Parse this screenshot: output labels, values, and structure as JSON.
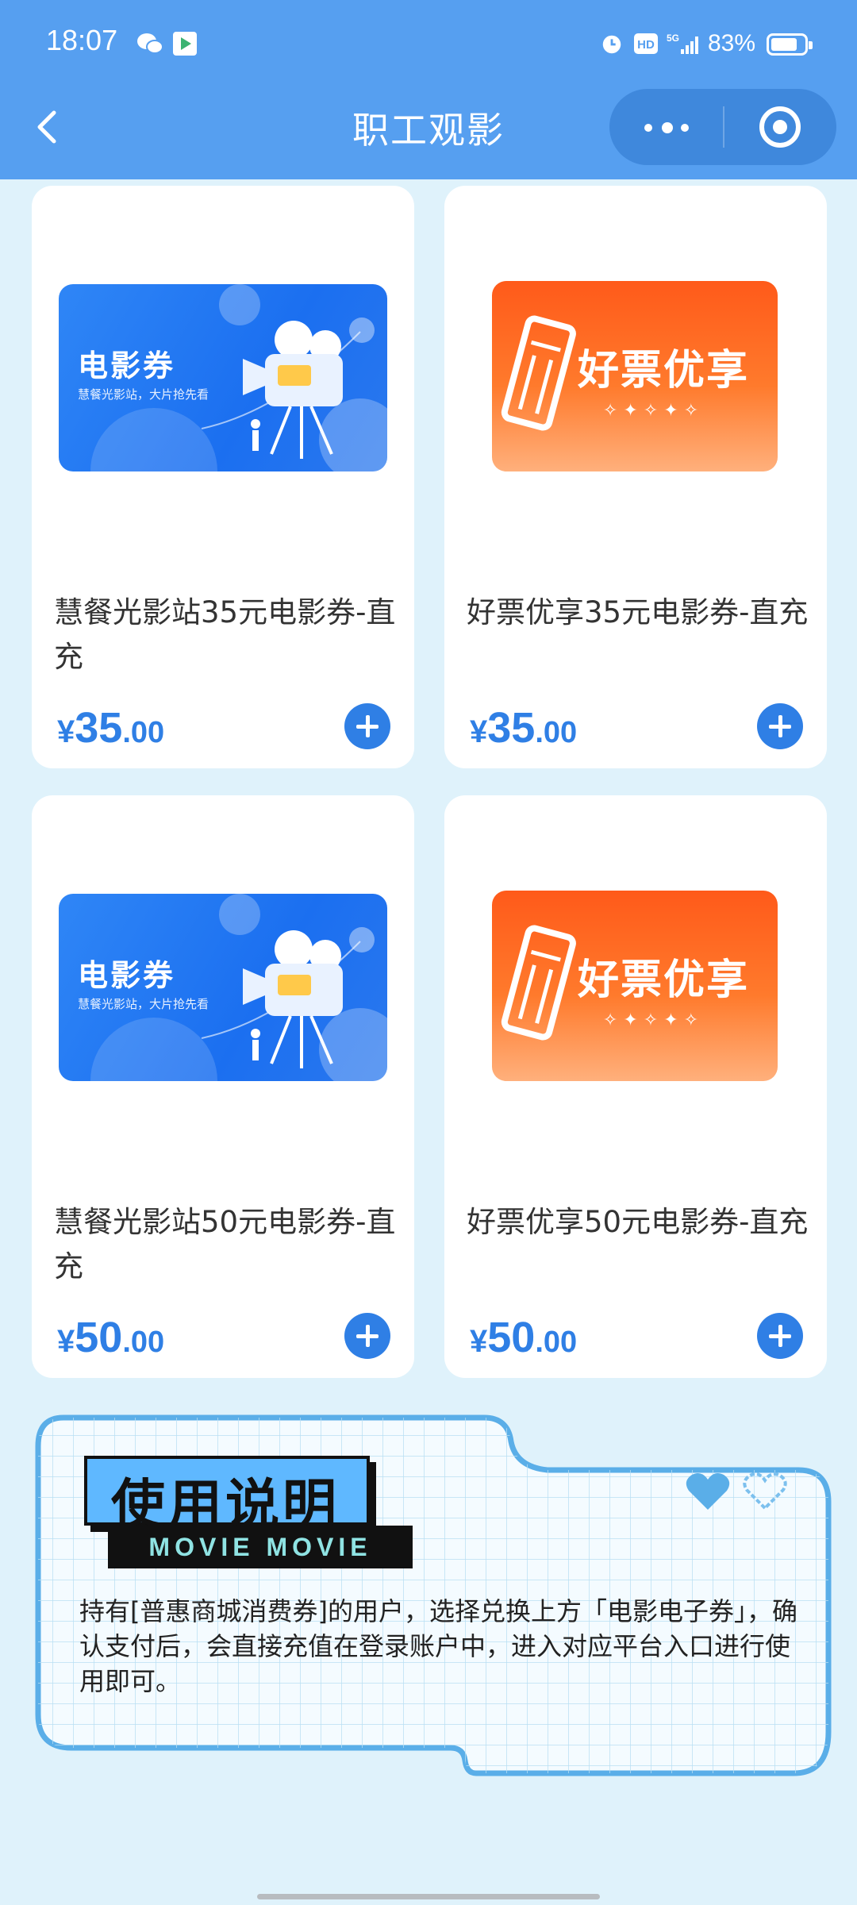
{
  "status_bar": {
    "time": "18:07",
    "network": "5G",
    "battery": "83%",
    "battery_level": 0.83
  },
  "header": {
    "title": "职工观影",
    "back_icon": "chevron-left-icon",
    "more_icon": "more-dots-icon",
    "close_icon": "target-circle-icon"
  },
  "products": [
    {
      "name": "慧餐光影站35元电影券-直充",
      "currency": "¥",
      "price_int": "35",
      "price_dec": ".00",
      "image": {
        "style": "blue",
        "title": "电影券",
        "subtitle": "慧餐光影站，大片抢先看"
      }
    },
    {
      "name": "好票优享35元电影券-直充",
      "currency": "¥",
      "price_int": "35",
      "price_dec": ".00",
      "image": {
        "style": "orange",
        "title": "好票优享"
      }
    },
    {
      "name": "慧餐光影站50元电影券-直充",
      "currency": "¥",
      "price_int": "50",
      "price_dec": ".00",
      "image": {
        "style": "blue",
        "title": "电影券",
        "subtitle": "慧餐光影站，大片抢先看"
      }
    },
    {
      "name": "好票优享50元电影券-直充",
      "currency": "¥",
      "price_int": "50",
      "price_dec": ".00",
      "image": {
        "style": "orange",
        "title": "好票优享"
      }
    }
  ],
  "instructions": {
    "title": "使用说明",
    "subtitle": "MOVIE MOVIE",
    "text": "持有[普惠商城消费券]的用户，选择兑换上方「电影电子券」，确认支付后，会直接充值在登录账户中，进入对应平台入口进行使用即可。"
  },
  "colors": {
    "header": "#569ff0",
    "accent": "#2f7fe5",
    "background": "#dff2fb",
    "orange": "#ff5a1a"
  }
}
